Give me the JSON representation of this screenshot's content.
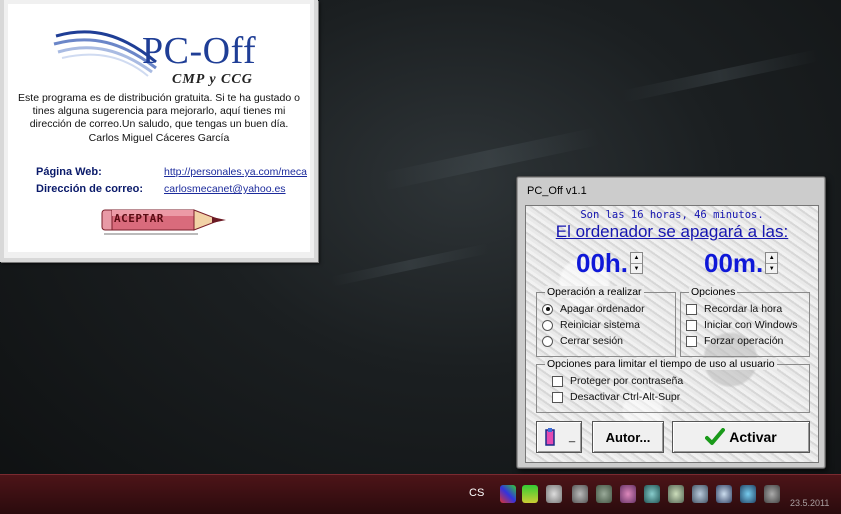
{
  "about": {
    "logo_title": "PC-Off",
    "logo_subtitle": "CMP y CCG",
    "description": "Este programa es de distribución gratuita. Si te ha gustado o tines alguna sugerencia para mejorarlo, aquí tienes mi dirección de correo.Un saludo, que tengas un buen día.",
    "author": "Carlos Miguel Cáceres García",
    "web_label": "Página Web:",
    "web_value": "http://personales.ya.com/meca",
    "email_label": "Dirección de correo:",
    "email_value": "carlosmecanet@yahoo.es",
    "accept_label": "ACEPTAR"
  },
  "pcoff": {
    "window_title": "PC_Off v1.1",
    "clock_text": "Son las 16 horas, 46 minutos.",
    "shutdown_title": "El ordenador se apagará a las:",
    "hours": "00h.",
    "minutes": "00m.",
    "operation_group": {
      "legend": "Operación a realizar",
      "options": [
        {
          "label": "Apagar ordenador",
          "selected": true
        },
        {
          "label": "Reiniciar sistema",
          "selected": false
        },
        {
          "label": "Cerrar sesión",
          "selected": false
        }
      ]
    },
    "options_group": {
      "legend": "Opciones",
      "options": [
        {
          "label": "Recordar la hora",
          "checked": false
        },
        {
          "label": "Iniciar con Windows",
          "checked": false
        },
        {
          "label": "Forzar operación",
          "checked": false
        }
      ]
    },
    "limit_group": {
      "legend": "Opciones para limitar el tiempo de uso al usuario",
      "options": [
        {
          "label": "Proteger por contraseña",
          "checked": false
        },
        {
          "label": "Desactivar Ctrl-Alt-Supr",
          "checked": false
        }
      ]
    },
    "minimize_label": "_",
    "author_button": "Autor...",
    "activate_button": "Activar"
  },
  "taskbar": {
    "language": "CS",
    "clock_date": "23.5.2011"
  },
  "colors": {
    "accent_blue": "#1515b0",
    "time_blue": "#0f18d8",
    "logo_blue": "#1f3e96",
    "check_green": "#1a9a1a",
    "taskbar_red": "#4d1418"
  },
  "icons": [
    "minimize-to-tray-icon",
    "green-checkmark-icon",
    "pencil-icon",
    "spin-up-icon",
    "spin-down-icon"
  ]
}
